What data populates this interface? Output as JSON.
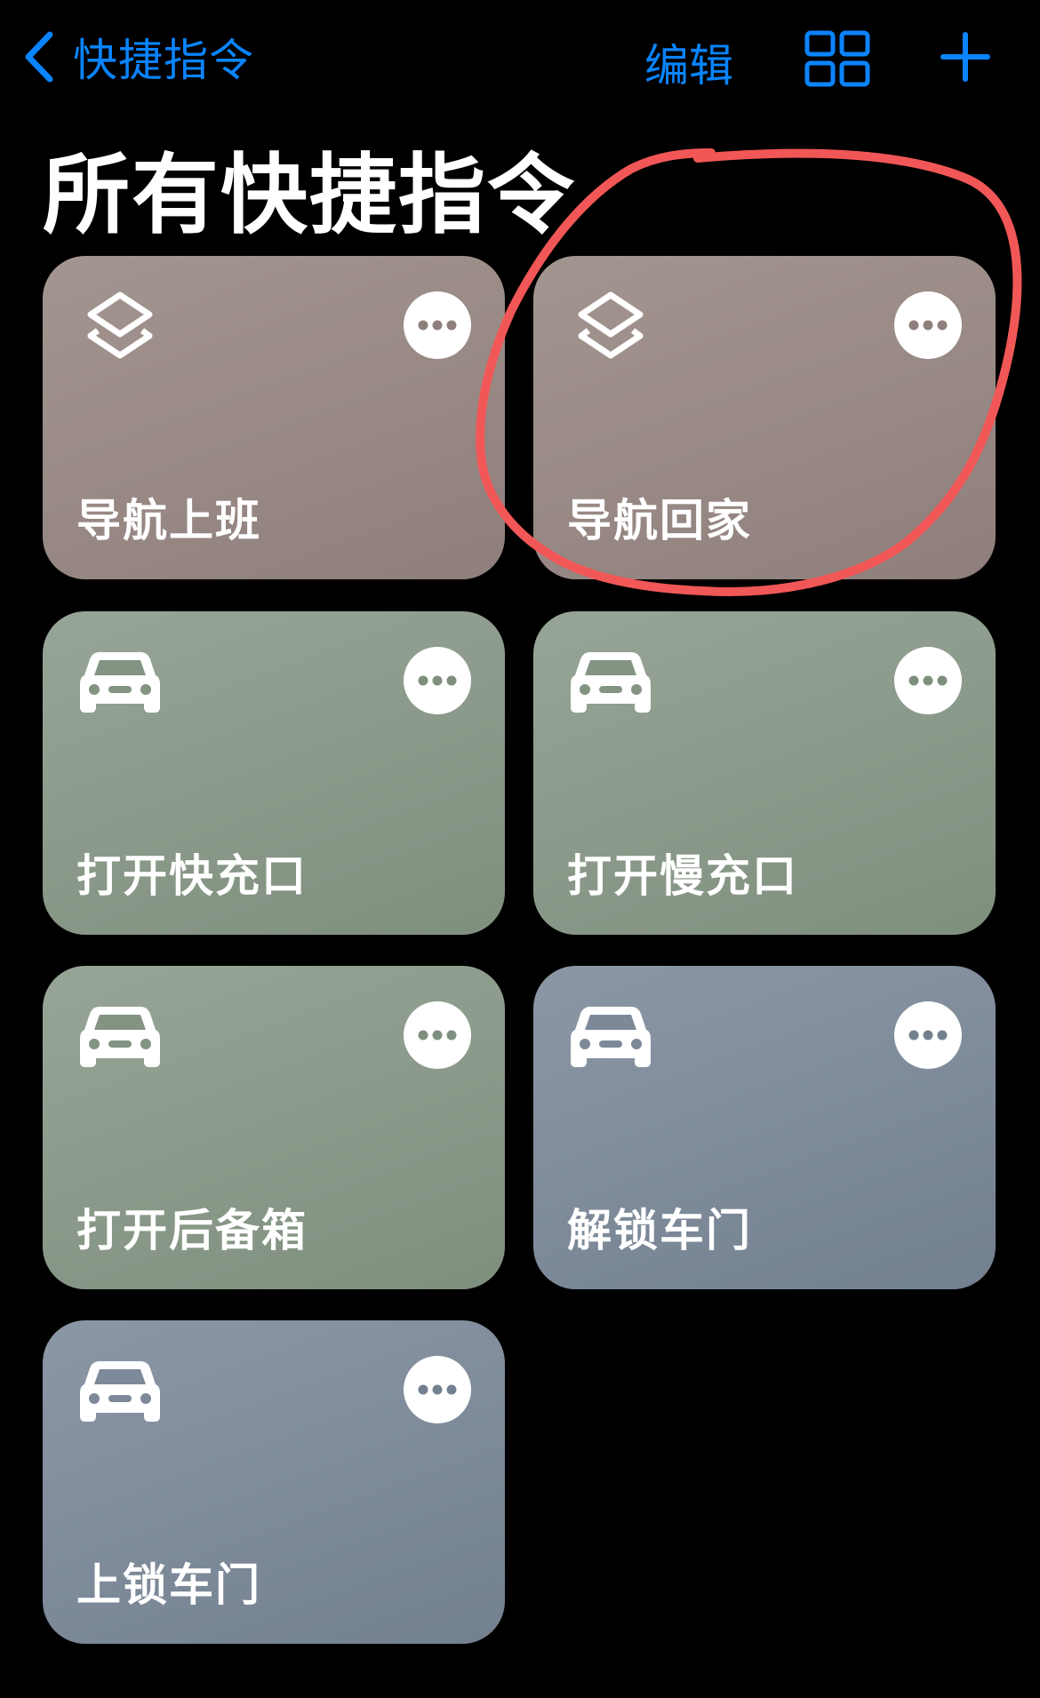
{
  "nav": {
    "back_label": "快捷指令",
    "edit_label": "编辑"
  },
  "page": {
    "title": "所有快捷指令"
  },
  "colors": {
    "accent": "#0a84ff",
    "annotation": "#f25757"
  },
  "shortcuts": [
    {
      "label": "导航上班",
      "icon": "layers-icon",
      "color": "brown"
    },
    {
      "label": "导航回家",
      "icon": "layers-icon",
      "color": "brown",
      "circled": true
    },
    {
      "label": "打开快充口",
      "icon": "car-icon",
      "color": "green"
    },
    {
      "label": "打开慢充口",
      "icon": "car-icon",
      "color": "green"
    },
    {
      "label": "打开后备箱",
      "icon": "car-icon",
      "color": "green"
    },
    {
      "label": "解锁车门",
      "icon": "car-icon",
      "color": "blue"
    },
    {
      "label": "上锁车门",
      "icon": "car-icon",
      "color": "blue"
    }
  ]
}
